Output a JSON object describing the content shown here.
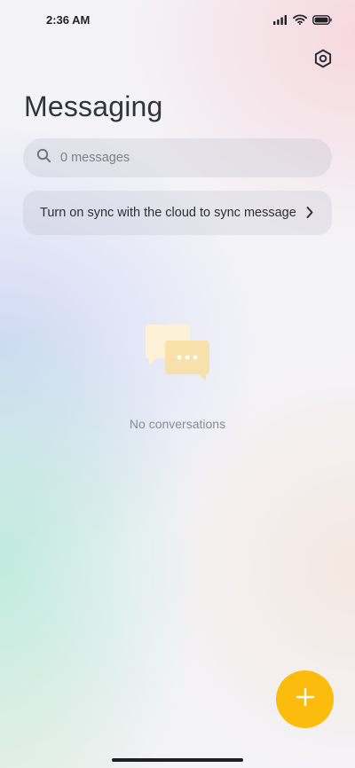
{
  "status_bar": {
    "time": "2:36 AM",
    "icons": [
      "signal-icon",
      "wifi-icon",
      "battery-icon"
    ]
  },
  "header": {
    "title": "Messaging",
    "settings_icon": "settings-icon"
  },
  "search": {
    "placeholder": "0 messages",
    "value": ""
  },
  "sync_banner": {
    "text": "Turn on sync with the cloud to sync messages"
  },
  "empty_state": {
    "icon": "chat-bubbles-icon",
    "text": "No conversations"
  },
  "fab": {
    "icon": "plus-icon",
    "color": "#fbbc0d"
  }
}
